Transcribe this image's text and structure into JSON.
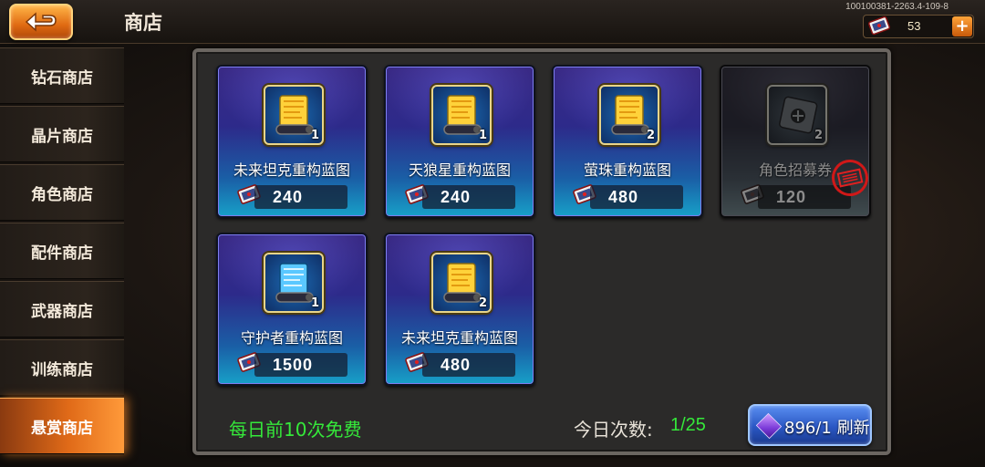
{
  "header": {
    "title": "商店",
    "build_id": "100100381-2263.4-109-8",
    "currency_amount": "53"
  },
  "sidebar": {
    "items": [
      {
        "label": "钻石商店"
      },
      {
        "label": "晶片商店"
      },
      {
        "label": "角色商店"
      },
      {
        "label": "配件商店"
      },
      {
        "label": "武器商店"
      },
      {
        "label": "训练商店"
      },
      {
        "label": "悬赏商店"
      }
    ],
    "active_index": 6
  },
  "shop": {
    "items": [
      {
        "name": "未来坦克重构蓝图",
        "qty": "1",
        "price": "240",
        "icon": "gold-blueprint-scroll-icon",
        "sold": false
      },
      {
        "name": "天狼星重构蓝图",
        "qty": "1",
        "price": "240",
        "icon": "gold-blueprint-scroll-icon",
        "sold": false
      },
      {
        "name": "萤珠重构蓝图",
        "qty": "2",
        "price": "480",
        "icon": "gold-blueprint-scroll-icon",
        "sold": false
      },
      {
        "name": "角色招募券",
        "qty": "2",
        "price": "120",
        "icon": "recruit-ticket-icon",
        "sold": true
      },
      {
        "name": "守护者重构蓝图",
        "qty": "1",
        "price": "1500",
        "icon": "blue-blueprint-scroll-icon",
        "sold": false
      },
      {
        "name": "未来坦克重构蓝图",
        "qty": "2",
        "price": "480",
        "icon": "gold-blueprint-scroll-icon",
        "sold": false
      }
    ],
    "free_note": "每日前10次免费",
    "daily_count_label": "今日次数:",
    "daily_count_value": "1/25",
    "refresh_label": "896/1 刷新"
  },
  "colors": {
    "accent_orange": "#e06a18",
    "green_text": "#35e83a",
    "card_top": "#3a2a86",
    "card_bottom": "#17a0c8"
  }
}
